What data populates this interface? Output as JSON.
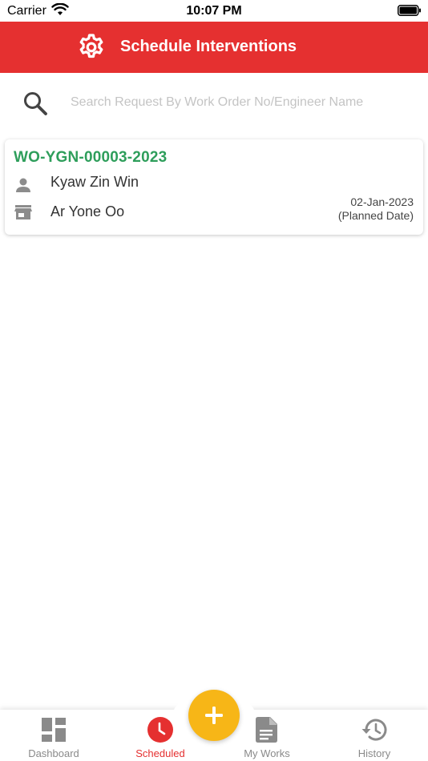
{
  "status_bar": {
    "carrier": "Carrier",
    "time": "10:07 PM"
  },
  "header": {
    "title": "Schedule Interventions",
    "icon": "gear-icon",
    "background": "#e53030"
  },
  "search": {
    "placeholder": "Search Request By Work Order No/Engineer Name",
    "value": ""
  },
  "work_orders": [
    {
      "number": "WO-YGN-00003-2023",
      "engineer": "Kyaw Zin Win",
      "site": "Ar Yone Oo",
      "date": "02-Jan-2023",
      "date_label": "(Planned Date)"
    }
  ],
  "bottom_nav": {
    "items": [
      {
        "label": "Dashboard",
        "icon": "dashboard-icon",
        "active": false
      },
      {
        "label": "Scheduled",
        "icon": "clock-icon",
        "active": true
      },
      {
        "label": "My Works",
        "icon": "document-icon",
        "active": false
      },
      {
        "label": "History",
        "icon": "history-icon",
        "active": false
      }
    ],
    "fab_icon": "plus-icon"
  },
  "colors": {
    "accent": "#e53030",
    "wo_number": "#2e9e5b",
    "fab": "#f7b617",
    "inactive_nav": "#8a8a8a"
  }
}
